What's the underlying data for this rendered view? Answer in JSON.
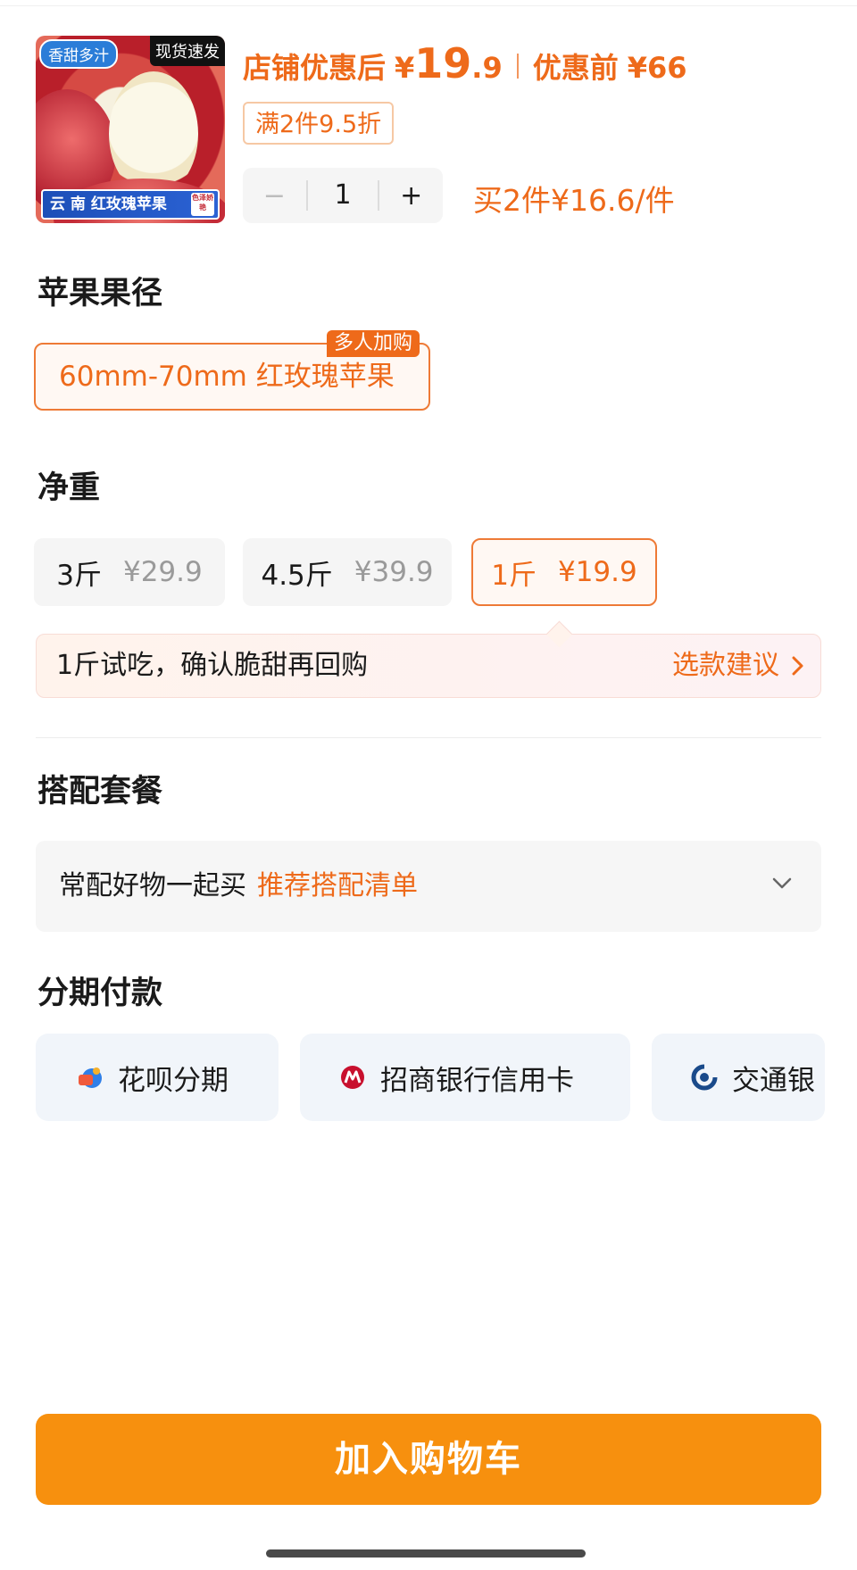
{
  "product": {
    "thumb_tag_left": "香甜多汁",
    "thumb_tag_right": "现货速发",
    "thumb_banner": "云 南 红玫瑰苹果",
    "thumb_badge": "色泽娇艳",
    "price_after_label": "店铺优惠后",
    "currency": "¥",
    "price_after_int": "19",
    "price_after_dec": ".9",
    "price_before_label": "优惠前",
    "price_before": "66",
    "discount_tag": "满2件9.5折",
    "quantity": "1",
    "minus_label": "−",
    "plus_label": "+",
    "bulk_price": "买2件¥16.6/件"
  },
  "diameter": {
    "title": "苹果果径",
    "option_label": "60mm-70mm 红玫瑰苹果",
    "hot_badge": "多人加购"
  },
  "weight": {
    "title": "净重",
    "options": [
      {
        "name": "3斤",
        "price": "¥29.9",
        "selected": false
      },
      {
        "name": "4.5斤",
        "price": "¥39.9",
        "selected": false
      },
      {
        "name": "1斤",
        "price": "¥19.9",
        "selected": true
      }
    ],
    "hint_text": "1斤试吃，确认脆甜再回购",
    "hint_link": "选款建议"
  },
  "combo": {
    "title": "搭配套餐",
    "text": "常配好物一起买",
    "link": "推荐搭配清单"
  },
  "installment": {
    "title": "分期付款",
    "options": [
      {
        "label": "花呗分期",
        "icon": "huabei-icon"
      },
      {
        "label": "招商银行信用卡",
        "icon": "cmb-bank-icon"
      },
      {
        "label": "交通银",
        "icon": "bocom-bank-icon"
      }
    ]
  },
  "footer": {
    "cart_button": "加入购物车"
  },
  "colors": {
    "accent": "#ee6a1a",
    "cart_button": "#f7900e"
  }
}
